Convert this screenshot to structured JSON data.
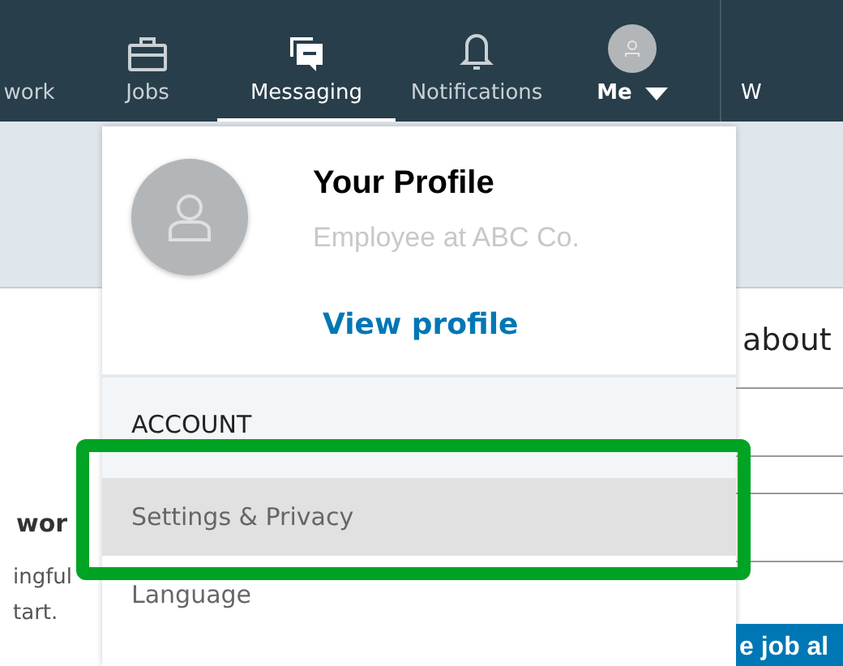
{
  "nav": {
    "items": [
      {
        "label": "work",
        "kind": "none",
        "selected": false
      },
      {
        "label": "Jobs",
        "kind": "briefcase",
        "selected": false
      },
      {
        "label": "Messaging",
        "kind": "messages",
        "selected": true
      },
      {
        "label": "Notifications",
        "kind": "bell",
        "selected": false
      },
      {
        "label": "Me",
        "kind": "avatar",
        "selected": false
      }
    ],
    "overflow": "W"
  },
  "dropdown": {
    "profile": {
      "name": "Your Profile",
      "headline": "Employee at ABC Co.",
      "link": "View profile"
    },
    "section": "ACCOUNT",
    "items": [
      {
        "label": "Settings & Privacy",
        "selected": true
      },
      {
        "label": "Language",
        "selected": false
      }
    ]
  },
  "page": {
    "left_texts": [
      "wor",
      "ingful",
      "tart."
    ],
    "right_text": "about",
    "right_button": "e job al"
  }
}
